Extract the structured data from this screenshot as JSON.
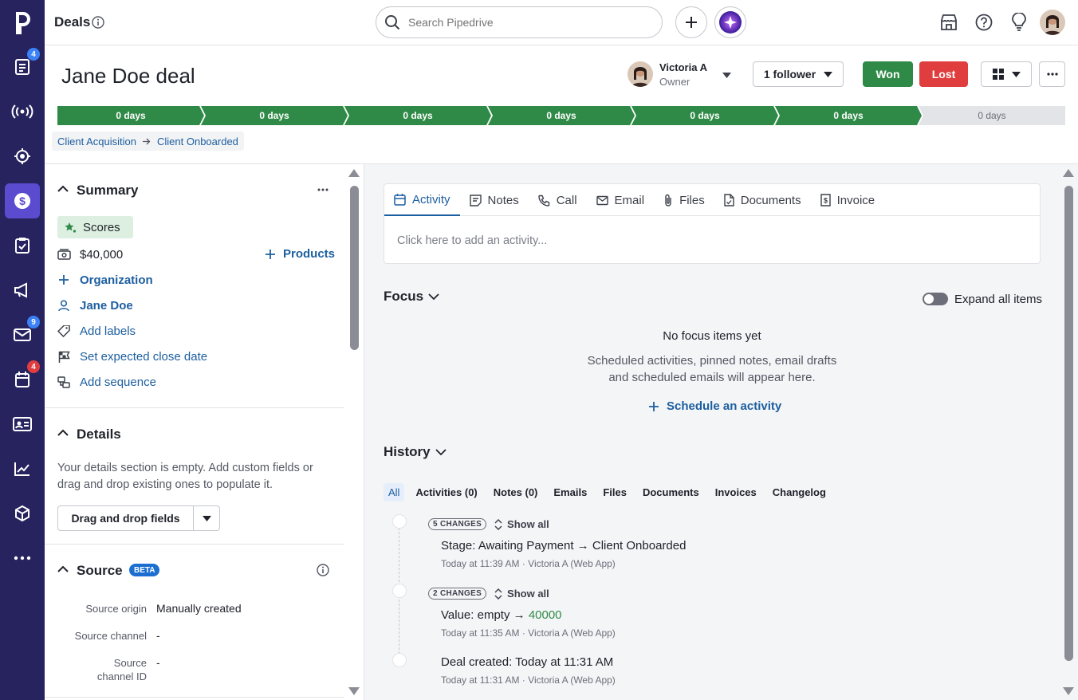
{
  "topbar": {
    "title": "Deals",
    "search_placeholder": "Search Pipedrive"
  },
  "nav": {
    "badges": {
      "leads": "4",
      "mail": "9",
      "calendar": "4"
    },
    "colors": {
      "bg": "#26235f",
      "active": "#5b4ccf"
    }
  },
  "deal": {
    "title": "Jane Doe deal",
    "owner_name": "Victoria A",
    "owner_role": "Owner",
    "followers": "1 follower",
    "won": "Won",
    "lost": "Lost"
  },
  "pipeline": {
    "stages": [
      "0 days",
      "0 days",
      "0 days",
      "0 days",
      "0 days",
      "0 days",
      "0 days"
    ],
    "completed": 6
  },
  "breadcrumb": {
    "from": "Client Acquisition",
    "to": "Client Onboarded"
  },
  "summary": {
    "title": "Summary",
    "scores": "Scores",
    "value": "$40,000",
    "products": "Products",
    "organization": "Organization",
    "person": "Jane Doe",
    "labels": "Add labels",
    "close_date": "Set expected close date",
    "sequence": "Add sequence"
  },
  "details": {
    "title": "Details",
    "empty_text": "Your details section is empty. Add custom fields or drag and drop existing ones to populate it.",
    "button": "Drag and drop fields"
  },
  "source": {
    "title": "Source",
    "badge": "BETA",
    "rows": [
      {
        "label": "Source origin",
        "value": "Manually created"
      },
      {
        "label": "Source channel",
        "value": "-"
      },
      {
        "label": "Source channel ID",
        "value": "-"
      }
    ]
  },
  "tabs": {
    "items": [
      "Activity",
      "Notes",
      "Call",
      "Email",
      "Files",
      "Documents",
      "Invoice"
    ],
    "placeholder": "Click here to add an activity..."
  },
  "focus": {
    "title": "Focus",
    "expand": "Expand all items",
    "empty_title": "No focus items yet",
    "empty_text_1": "Scheduled activities, pinned notes, email drafts",
    "empty_text_2": "and scheduled emails will appear here.",
    "schedule": "Schedule an activity"
  },
  "history": {
    "title": "History",
    "filters": [
      "All",
      "Activities (0)",
      "Notes (0)",
      "Emails",
      "Files",
      "Documents",
      "Invoices",
      "Changelog"
    ],
    "entries": [
      {
        "changes": "5 CHANGES",
        "show_all": "Show all",
        "label": "Stage",
        "from": "Awaiting Payment",
        "to": "Client Onboarded",
        "meta": "Today at 11:39 AM · Victoria A (Web App)"
      },
      {
        "changes": "2 CHANGES",
        "show_all": "Show all",
        "label": "Value",
        "from": "empty",
        "to": "40000",
        "meta": "Today at 11:35 AM · Victoria A (Web App)"
      },
      {
        "label": "Deal created",
        "value": "Today at 11:31 AM",
        "meta": "Today at 11:31 AM · Victoria A (Web App)"
      }
    ]
  },
  "colors": {
    "green": "#2f8a47",
    "red": "#e03e3e",
    "blue": "#1c5e9f"
  }
}
